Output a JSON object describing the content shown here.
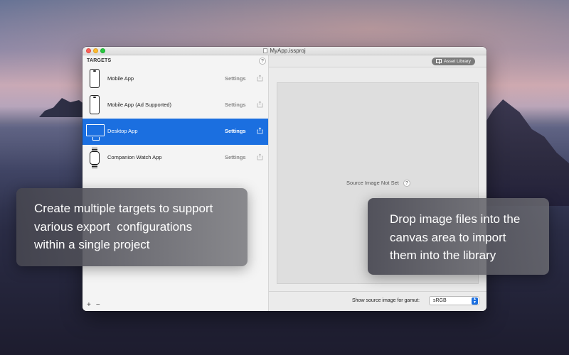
{
  "window": {
    "title": "MyApp.issproj"
  },
  "sidebar": {
    "header": "TARGETS",
    "help": "?",
    "targets": [
      {
        "label": "Mobile App",
        "settings": "Settings",
        "icon": "phone-icon",
        "selected": false
      },
      {
        "label": "Mobile App (Ad Supported)",
        "settings": "Settings",
        "icon": "phone-icon",
        "selected": false
      },
      {
        "label": "Desktop App",
        "settings": "Settings",
        "icon": "monitor-icon",
        "selected": true
      },
      {
        "label": "Companion Watch App",
        "settings": "Settings",
        "icon": "watch-icon",
        "selected": false
      }
    ],
    "add_label": "+",
    "remove_label": "−"
  },
  "main": {
    "asset_library_label": "Asset Library",
    "canvas_placeholder": "Source Image Not Set",
    "canvas_help": "?",
    "gamut_label": "Show source image for gamut:",
    "gamut_value": "sRGB"
  },
  "captions": {
    "left": [
      "Create multiple targets to support",
      "various export  configurations",
      "within a single project"
    ],
    "right": [
      "Drop image files into the",
      "canvas area to import",
      "them into the library"
    ]
  },
  "colors": {
    "selection": "#1b6fe0",
    "close": "#fc5f57",
    "minimize": "#fdbc2e",
    "maximize": "#28c840"
  }
}
